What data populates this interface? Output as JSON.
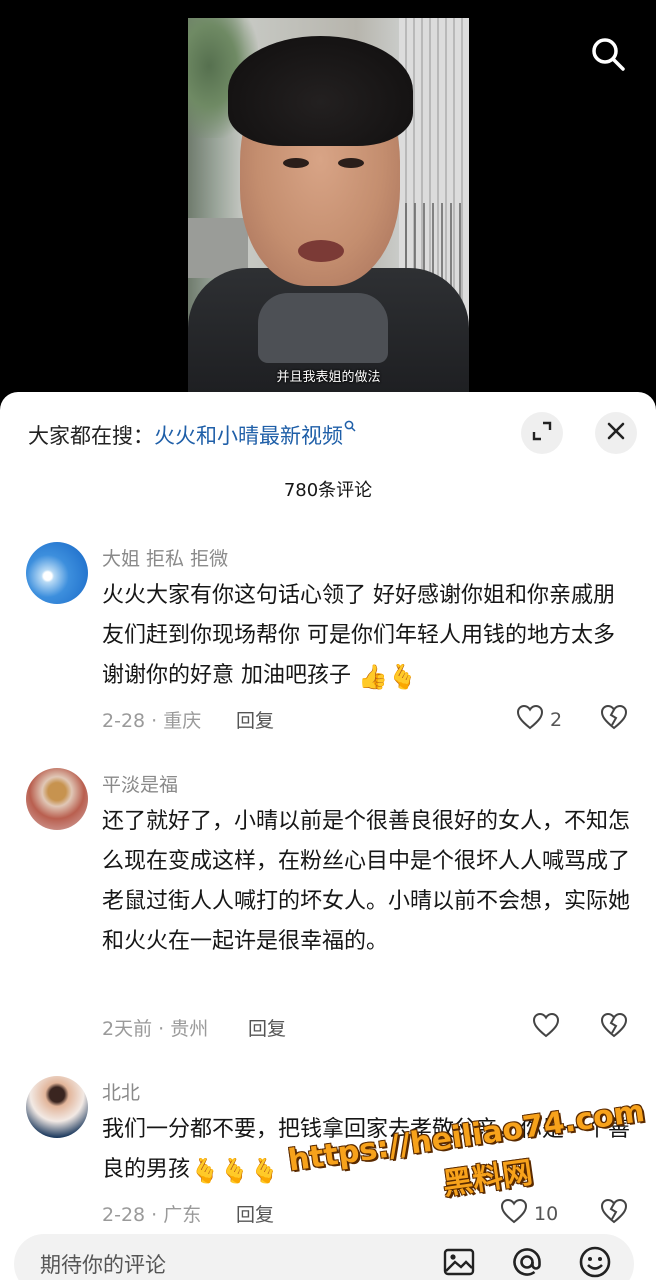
{
  "video": {
    "subtitle": "并且我表姐的做法"
  },
  "sheet": {
    "search_prefix": "大家都在搜：",
    "search_keyword": "火火和小晴最新视频",
    "comment_count": "780条评论"
  },
  "comments": [
    {
      "username": "大姐 拒私 拒微",
      "text": "火火大家有你这句话心领了 好好感谢你姐和你亲戚朋友们赶到你现场帮你 可是你们年轻人用钱的地方太多 谢谢你的好意 加油吧孩子",
      "date_location": "2-28 · 重庆",
      "reply_label": "回复",
      "like_count": "2"
    },
    {
      "username": "平淡是福",
      "text": "还了就好了，小晴以前是个很善良很好的女人，不知怎么现在变成这样，在粉丝心目中是个很坏人人喊骂成了老鼠过街人人喊打的坏女人。小晴以前不会想，实际她和火火在一起许是很幸福的。",
      "date_location": "2天前 · 贵州",
      "reply_label": "回复",
      "like_count": ""
    },
    {
      "username": "北北",
      "text": "我们一分都不要，把钱拿回家去孝敬父亲，你是一个善良的男孩",
      "date_location": "2-28 · 广东",
      "reply_label": "回复",
      "like_count": "10"
    }
  ],
  "input": {
    "placeholder": "期待你的评论"
  },
  "watermark": {
    "url": "https://heiliao74.com",
    "name": "黑料网"
  },
  "colors": {
    "keyword_blue": "#1f5fa8",
    "watermark_orange": "#f7a21b"
  },
  "icons": [
    "search-icon",
    "expand-icon",
    "close-icon",
    "heart-icon",
    "broken-heart-icon",
    "image-icon",
    "at-icon",
    "emoji-icon"
  ]
}
